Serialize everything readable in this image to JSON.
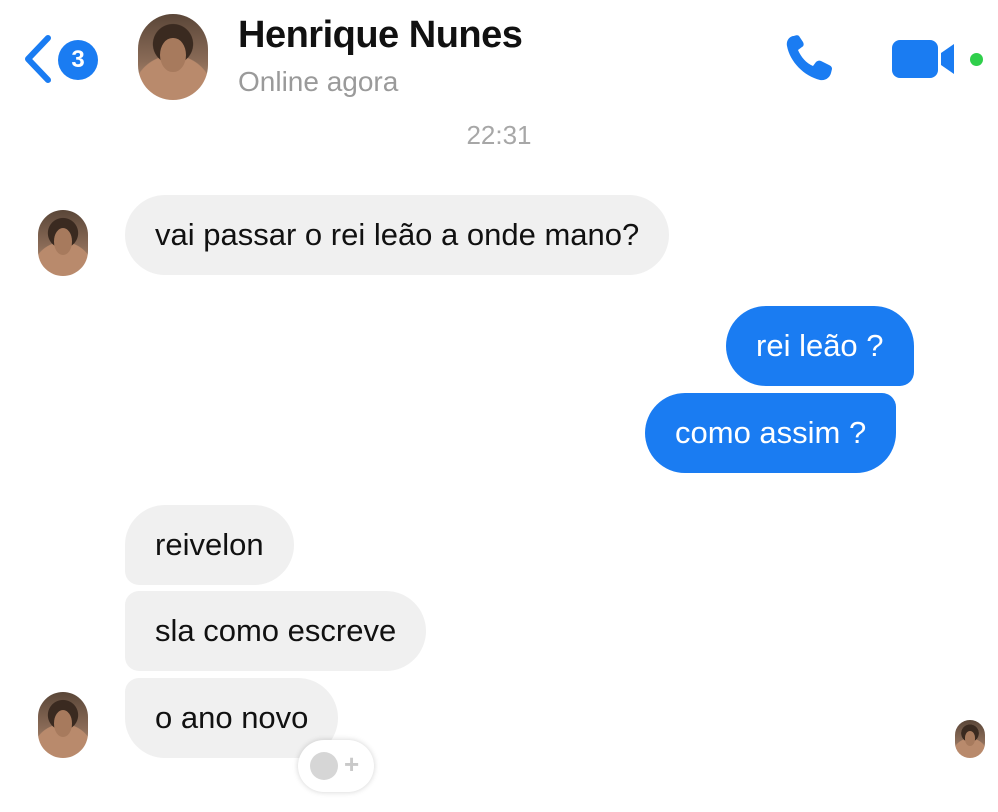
{
  "header": {
    "unread_count": "3",
    "contact_name": "Henrique Nunes",
    "status": "Online agora",
    "icons": {
      "back": "chevron-left-icon",
      "call": "phone-icon",
      "video": "video-camera-icon",
      "online": "online-dot"
    }
  },
  "timestamp": "22:31",
  "messages": [
    {
      "direction": "incoming",
      "text": "vai passar o rei leão a onde mano?"
    },
    {
      "direction": "outgoing",
      "text": "rei leão ?"
    },
    {
      "direction": "outgoing",
      "text": "como assim ?"
    },
    {
      "direction": "incoming",
      "text": "reivelon"
    },
    {
      "direction": "incoming",
      "text": "sla como escreve"
    },
    {
      "direction": "incoming",
      "text": "o ano novo"
    }
  ],
  "reaction_button": {
    "icon": "smile-add-icon"
  },
  "colors": {
    "accent": "#1a7cf2",
    "incoming_bubble": "#f0f0f0",
    "online": "#2fcf4b",
    "muted_text": "#9a9a9a"
  }
}
